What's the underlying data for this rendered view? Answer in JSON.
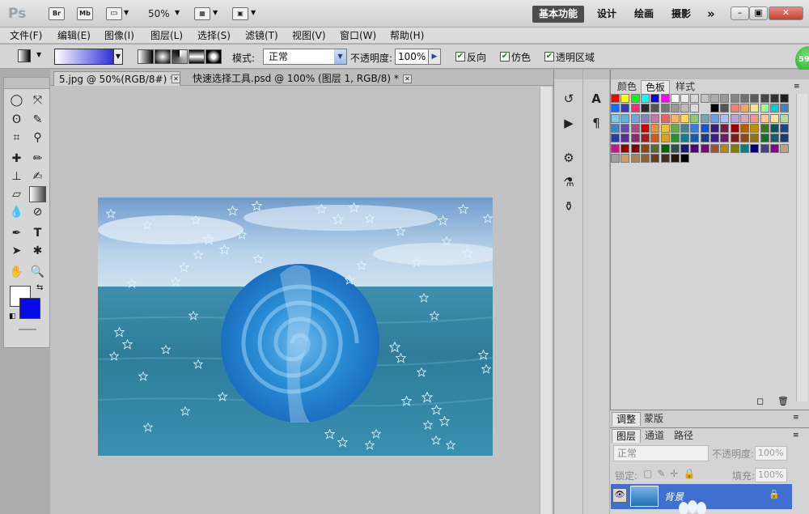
{
  "titlebar": {
    "logo": "Ps",
    "bridge": "Br",
    "minibridge": "Mb",
    "zoom": "50%",
    "workspaces": [
      "基本功能",
      "设计",
      "绘画",
      "摄影"
    ],
    "more": "»"
  },
  "menu": [
    "文件(F)",
    "编辑(E)",
    "图像(I)",
    "图层(L)",
    "选择(S)",
    "滤镜(T)",
    "视图(V)",
    "窗口(W)",
    "帮助(H)"
  ],
  "options": {
    "mode_label": "模式:",
    "mode_value": "正常",
    "opacity_label": "不透明度:",
    "opacity_value": "100%",
    "reverse": "反向",
    "dither": "仿色",
    "transparency": "透明区域",
    "gradient_from": "#ffffff",
    "gradient_to": "#1d1dd9"
  },
  "badge": "59",
  "documents": {
    "tabs": [
      {
        "label": "5.jpg @ 50%(RGB/8#) *",
        "active": true
      },
      {
        "label": "快速选择工具.psd @ 100% (图层 1, RGB/8) *",
        "active": false
      }
    ]
  },
  "colors": {
    "foreground": "#ffffff",
    "background": "#0a0ae8",
    "layer_selected": "#3f6fd1"
  },
  "swatch_panel": {
    "tabs": [
      "颜色",
      "色板",
      "样式"
    ],
    "active": "色板"
  },
  "adjust_panel": {
    "tabs": [
      "调整",
      "蒙版"
    ]
  },
  "layers_panel": {
    "tabs": [
      "图层",
      "通道",
      "路径"
    ],
    "blend_mode": "正常",
    "opacity_label": "不透明度:",
    "opacity_value": "100%",
    "lock_label": "锁定:",
    "fill_label": "填充:",
    "fill_value": "100%",
    "layer_name": "背景"
  }
}
